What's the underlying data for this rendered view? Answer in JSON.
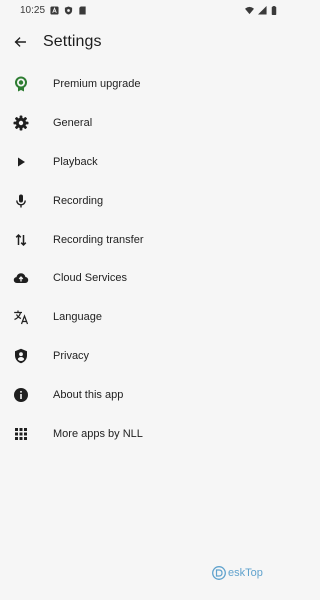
{
  "status_bar": {
    "time": "10:25"
  },
  "app_bar": {
    "title": "Settings"
  },
  "settings": [
    {
      "label": "Premium upgrade",
      "icon": "premium-badge-icon"
    },
    {
      "label": "General",
      "icon": "gear-icon"
    },
    {
      "label": "Playback",
      "icon": "play-icon"
    },
    {
      "label": "Recording",
      "icon": "microphone-icon"
    },
    {
      "label": "Recording transfer",
      "icon": "transfer-arrows-icon"
    },
    {
      "label": "Cloud Services",
      "icon": "cloud-upload-icon"
    },
    {
      "label": "Language",
      "icon": "translate-icon"
    },
    {
      "label": "Privacy",
      "icon": "privacy-shield-icon"
    },
    {
      "label": "About this app",
      "icon": "info-icon"
    },
    {
      "label": "More apps by NLL",
      "icon": "apps-grid-icon"
    }
  ],
  "colors": {
    "premium_accent": "#2e7d32",
    "icon": "#1f1f1f",
    "background": "#f6f6f6"
  },
  "watermark": {
    "text": "eskTop"
  }
}
